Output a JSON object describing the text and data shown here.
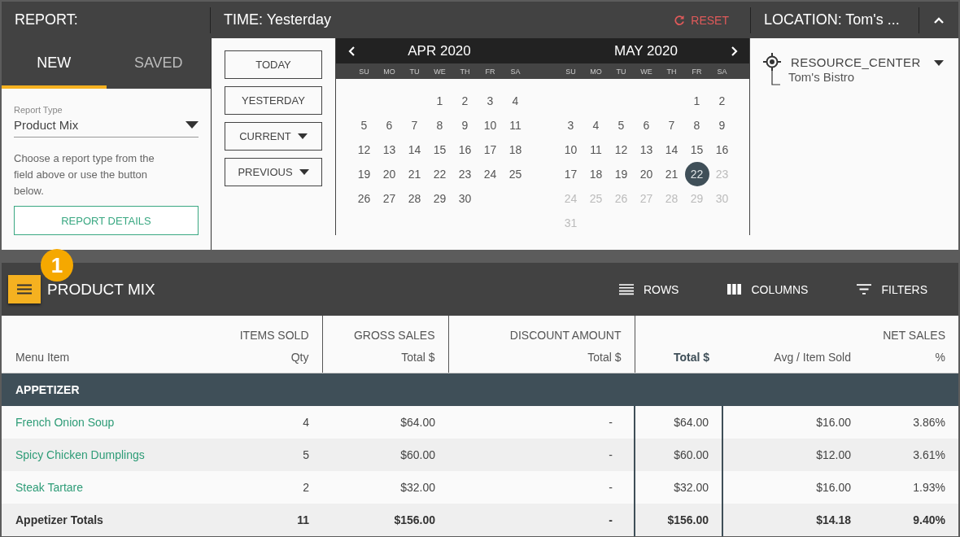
{
  "header": {
    "report_label": "REPORT:",
    "time_label": "TIME: Yesterday",
    "reset": "RESET",
    "location_label": "LOCATION: Tom's ..."
  },
  "tabs": [
    {
      "label": "NEW",
      "selected": true
    },
    {
      "label": "SAVED",
      "selected": false
    }
  ],
  "report_type": {
    "label": "Report Type",
    "value": "Product Mix"
  },
  "help_text": "Choose a report type from the field above or use the button below.",
  "details_button": "REPORT DETAILS",
  "quick_ranges": [
    {
      "label": "TODAY",
      "has_menu": false
    },
    {
      "label": "YESTERDAY",
      "has_menu": false
    },
    {
      "label": "CURRENT",
      "has_menu": true
    },
    {
      "label": "PREVIOUS",
      "has_menu": true
    }
  ],
  "calendar": {
    "months": [
      {
        "title": "APR 2020",
        "weekdays": [
          "SU",
          "MO",
          "TU",
          "WE",
          "TH",
          "FR",
          "SA"
        ],
        "weeks": [
          [
            {
              "day": "1",
              "selected": false,
              "disabled": false
            },
            {
              "day": "2",
              "selected": false,
              "disabled": false
            },
            {
              "day": "3",
              "selected": false,
              "disabled": false
            },
            {
              "day": "4",
              "selected": false,
              "disabled": false
            }
          ],
          [
            {
              "day": "5",
              "selected": false,
              "disabled": false
            },
            {
              "day": "6",
              "selected": false,
              "disabled": false
            },
            {
              "day": "7",
              "selected": false,
              "disabled": false
            },
            {
              "day": "8",
              "selected": false,
              "disabled": false
            },
            {
              "day": "9",
              "selected": false,
              "disabled": false
            },
            {
              "day": "10",
              "selected": false,
              "disabled": false
            },
            {
              "day": "11",
              "selected": false,
              "disabled": false
            }
          ],
          [
            {
              "day": "12",
              "selected": false,
              "disabled": false
            },
            {
              "day": "13",
              "selected": false,
              "disabled": false
            },
            {
              "day": "14",
              "selected": false,
              "disabled": false
            },
            {
              "day": "15",
              "selected": false,
              "disabled": false
            },
            {
              "day": "16",
              "selected": false,
              "disabled": false
            },
            {
              "day": "17",
              "selected": false,
              "disabled": false
            },
            {
              "day": "18",
              "selected": false,
              "disabled": false
            }
          ],
          [
            {
              "day": "19",
              "selected": false,
              "disabled": false
            },
            {
              "day": "20",
              "selected": false,
              "disabled": false
            },
            {
              "day": "21",
              "selected": false,
              "disabled": false
            },
            {
              "day": "22",
              "selected": false,
              "disabled": false
            },
            {
              "day": "23",
              "selected": false,
              "disabled": false
            },
            {
              "day": "24",
              "selected": false,
              "disabled": false
            },
            {
              "day": "25",
              "selected": false,
              "disabled": false
            }
          ],
          [
            {
              "day": "26",
              "selected": false,
              "disabled": false
            },
            {
              "day": "27",
              "selected": false,
              "disabled": false
            },
            {
              "day": "28",
              "selected": false,
              "disabled": false
            },
            {
              "day": "29",
              "selected": false,
              "disabled": false
            },
            {
              "day": "30",
              "selected": false,
              "disabled": false
            }
          ]
        ]
      },
      {
        "title": "MAY 2020",
        "weekdays": [
          "SU",
          "MO",
          "TU",
          "WE",
          "TH",
          "FR",
          "SA"
        ],
        "weeks": [
          [
            {
              "day": "1",
              "selected": false,
              "disabled": false
            },
            {
              "day": "2",
              "selected": false,
              "disabled": false
            }
          ],
          [
            {
              "day": "3",
              "selected": false,
              "disabled": false
            },
            {
              "day": "4",
              "selected": false,
              "disabled": false
            },
            {
              "day": "5",
              "selected": false,
              "disabled": false
            },
            {
              "day": "6",
              "selected": false,
              "disabled": false
            },
            {
              "day": "7",
              "selected": false,
              "disabled": false
            },
            {
              "day": "8",
              "selected": false,
              "disabled": false
            },
            {
              "day": "9",
              "selected": false,
              "disabled": false
            }
          ],
          [
            {
              "day": "10",
              "selected": false,
              "disabled": false
            },
            {
              "day": "11",
              "selected": false,
              "disabled": false
            },
            {
              "day": "12",
              "selected": false,
              "disabled": false
            },
            {
              "day": "13",
              "selected": false,
              "disabled": false
            },
            {
              "day": "14",
              "selected": false,
              "disabled": false
            },
            {
              "day": "15",
              "selected": false,
              "disabled": false
            },
            {
              "day": "16",
              "selected": false,
              "disabled": false
            }
          ],
          [
            {
              "day": "17",
              "selected": false,
              "disabled": false
            },
            {
              "day": "18",
              "selected": false,
              "disabled": false
            },
            {
              "day": "19",
              "selected": false,
              "disabled": false
            },
            {
              "day": "20",
              "selected": false,
              "disabled": false
            },
            {
              "day": "21",
              "selected": false,
              "disabled": false
            },
            {
              "day": "22",
              "selected": true,
              "disabled": false
            },
            {
              "day": "23",
              "selected": false,
              "disabled": true
            }
          ],
          [
            {
              "day": "24",
              "selected": false,
              "disabled": true
            },
            {
              "day": "25",
              "selected": false,
              "disabled": true
            },
            {
              "day": "26",
              "selected": false,
              "disabled": true
            },
            {
              "day": "27",
              "selected": false,
              "disabled": true
            },
            {
              "day": "28",
              "selected": false,
              "disabled": true
            },
            {
              "day": "29",
              "selected": false,
              "disabled": true
            },
            {
              "day": "30",
              "selected": false,
              "disabled": true
            }
          ],
          [
            {
              "day": "31",
              "selected": false,
              "disabled": true
            }
          ]
        ]
      }
    ]
  },
  "location_tree": [
    {
      "label": "RESOURCE_CENTER",
      "expanded": true,
      "children": [
        {
          "label": "Tom's Bistro"
        }
      ]
    }
  ],
  "report": {
    "badge": "1",
    "title": "PRODUCT MIX",
    "actions": [
      {
        "kind": "rows",
        "label": "ROWS"
      },
      {
        "kind": "columns",
        "label": "COLUMNS"
      },
      {
        "kind": "filters",
        "label": "FILTERS"
      }
    ]
  },
  "table": {
    "columns": [
      {
        "label": "Menu Item",
        "sorted": false
      },
      {
        "group": "ITEMS SOLD",
        "label": "Qty",
        "sorted": false
      },
      {
        "group": "GROSS SALES",
        "label": "Total $",
        "sorted": false
      },
      {
        "group": "DISCOUNT AMOUNT",
        "label": "Total $",
        "sorted": false
      },
      {
        "label": "Total $",
        "sorted": true
      },
      {
        "label": "Avg / Item Sold",
        "sorted": false
      },
      {
        "group": "NET SALES",
        "label": "%",
        "sorted": false
      }
    ],
    "groups": [
      {
        "label": "APPETIZER",
        "rows": [
          {
            "kind": "item",
            "cells": [
              "French Onion Soup",
              "4",
              "$64.00",
              "-",
              "$64.00",
              "$16.00",
              "3.86%"
            ]
          },
          {
            "kind": "item",
            "cells": [
              "Spicy Chicken Dumplings",
              "5",
              "$60.00",
              "-",
              "$60.00",
              "$12.00",
              "3.61%"
            ]
          },
          {
            "kind": "item",
            "cells": [
              "Steak Tartare",
              "2",
              "$32.00",
              "-",
              "$32.00",
              "$16.00",
              "1.93%"
            ]
          },
          {
            "kind": "total",
            "cells": [
              "Appetizer Totals",
              "11",
              "$156.00",
              "-",
              "$156.00",
              "$14.18",
              "9.40%"
            ]
          }
        ]
      }
    ]
  }
}
